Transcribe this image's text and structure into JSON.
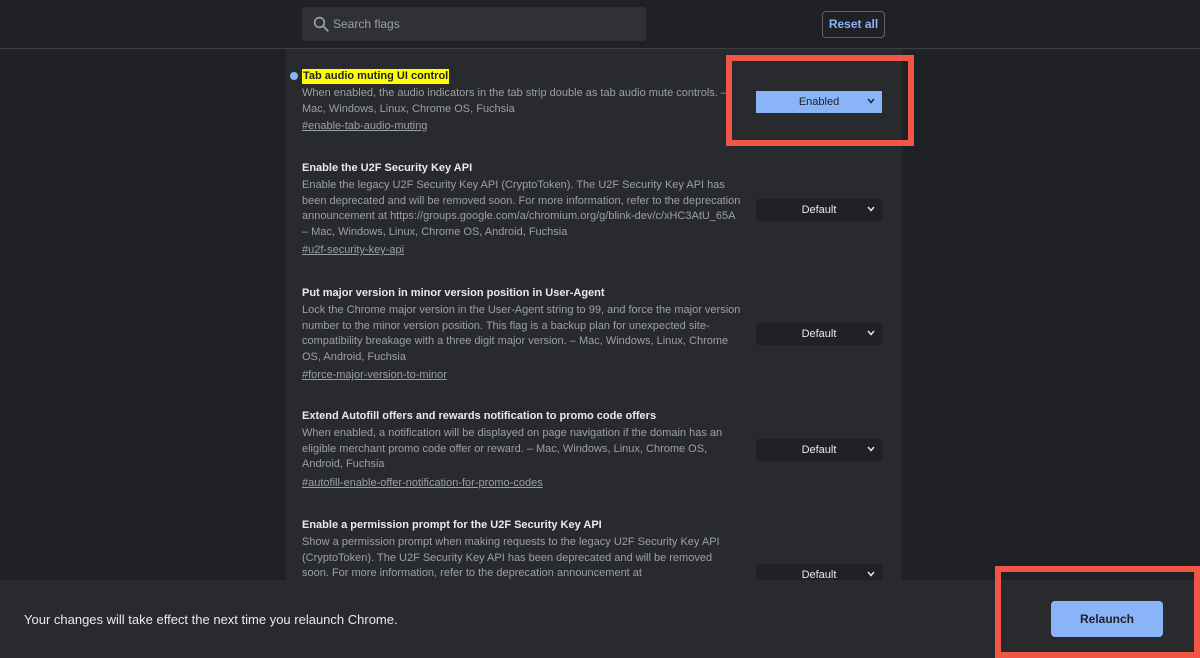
{
  "header": {
    "search_placeholder": "Search flags",
    "reset_label": "Reset all"
  },
  "flags": [
    {
      "title": "Tab audio muting UI control",
      "description": "When enabled, the audio indicators in the tab strip double as tab audio mute controls. – Mac, Windows, Linux, Chrome OS, Fuchsia",
      "link": "#enable-tab-audio-muting",
      "value": "Enabled",
      "modified": true
    },
    {
      "title": "Enable the U2F Security Key API",
      "description": "Enable the legacy U2F Security Key API (CryptoToken). The U2F Security Key API has been deprecated and will be removed soon. For more information, refer to the deprecation announcement at https://groups.google.com/a/chromium.org/g/blink-dev/c/xHC3AtU_65A – Mac, Windows, Linux, Chrome OS, Android, Fuchsia",
      "link": "#u2f-security-key-api",
      "value": "Default",
      "modified": false
    },
    {
      "title": "Put major version in minor version position in User-Agent",
      "description": "Lock the Chrome major version in the User-Agent string to 99, and force the major version number to the minor version position. This flag is a backup plan for unexpected site-compatibility breakage with a three digit major version. – Mac, Windows, Linux, Chrome OS, Android, Fuchsia",
      "link": "#force-major-version-to-minor",
      "value": "Default",
      "modified": false
    },
    {
      "title": "Extend Autofill offers and rewards notification to promo code offers",
      "description": "When enabled, a notification will be displayed on page navigation if the domain has an eligible merchant promo code offer or reward. – Mac, Windows, Linux, Chrome OS, Android, Fuchsia",
      "link": "#autofill-enable-offer-notification-for-promo-codes",
      "value": "Default",
      "modified": false
    },
    {
      "title": "Enable a permission prompt for the U2F Security Key API",
      "description": "Show a permission prompt when making requests to the legacy U2F Security Key API (CryptoToken). The U2F Security Key API has been deprecated and will be removed soon. For more information, refer to the deprecation announcement at",
      "link": "",
      "value": "Default",
      "modified": false
    }
  ],
  "footer": {
    "message": "Your changes will take effect the next time you relaunch Chrome.",
    "relaunch_label": "Relaunch"
  },
  "colors": {
    "background": "#202124",
    "panel": "#292a2d",
    "accent": "#8ab4f8",
    "highlight": "#ffff00",
    "annotation": "#f05545"
  }
}
